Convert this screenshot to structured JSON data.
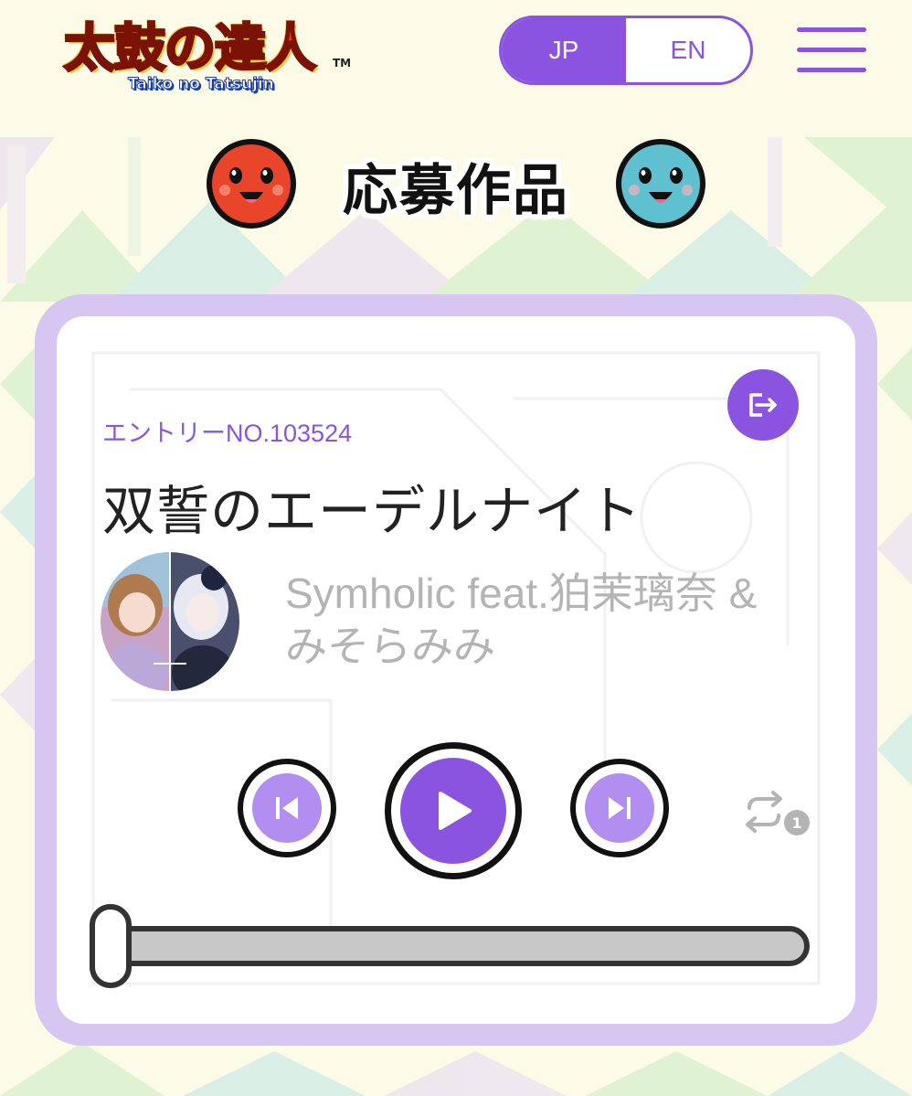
{
  "header": {
    "logo_text": "太鼓の達人",
    "logo_subtext": "Taiko no Tatsujin",
    "logo_tm": "TM",
    "lang_jp": "JP",
    "lang_en": "EN",
    "menu_icon": "hamburger-menu-icon"
  },
  "page": {
    "title": "応募作品",
    "title_left_icon": "don-red-face-icon",
    "title_right_icon": "katsu-blue-face-icon"
  },
  "player": {
    "entry_no": "エントリーNO.103524",
    "song_title": "双誓のエーデルナイト",
    "artist": "Symholic feat.狛茉璃奈 & みそらみみ",
    "share_icon": "share-exit-icon",
    "prev_icon": "skip-previous-icon",
    "play_icon": "play-icon",
    "next_icon": "skip-next-icon",
    "repeat_icon": "repeat-one-icon",
    "repeat_badge": "1",
    "progress": 0
  },
  "colors": {
    "accent": "#8a54e0",
    "accent_light": "#b28ef0",
    "card_border": "#d7c6f1",
    "artist_text": "#b4b4b4"
  }
}
